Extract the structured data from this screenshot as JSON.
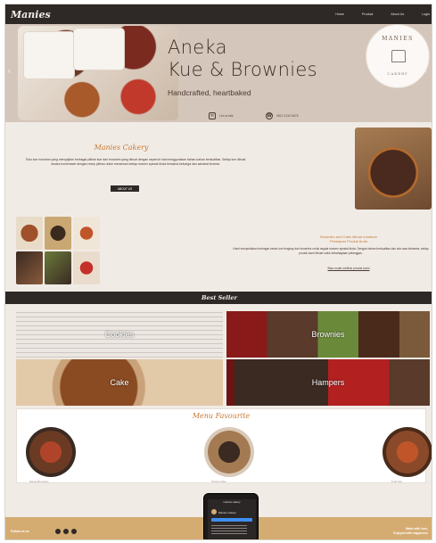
{
  "brand": {
    "logo": "Manies"
  },
  "nav": [
    "Home",
    "Product",
    "About Us",
    "Login"
  ],
  "hero": {
    "line1": "Aneka",
    "line2": "Kue & Brownies",
    "tagline": "Handcrafted, heartbaked",
    "badge_top": "MANIES",
    "badge_bottom": "CAKERY",
    "contact_email": "Let us talk",
    "contact_phone": "0813 1234 5678"
  },
  "about": {
    "title": "Manies Cakery",
    "body": "Toko kue rumahan yang menyajikan berbagai pilihan kue dan brownies yang dibuat dengan sepenuh hati menggunakan bahan-bahan berkualitas. Setiap kue dibuat secara homemade dengan resep pilihan untuk menemani setiap momen spesial Anda bersama keluarga dan sahabat tercinta.",
    "button": "ABOUT US"
  },
  "intro": {
    "title_line1": "Brownies and Cake dibuat rumahan",
    "title_line2": "Persiapan Produk Anda",
    "body": "Kami menyediakan berbagai varian kue lengkap dan brownies untuk segala momen spesial Anda. Dengan bahan berkualitas dan cita rasa istimewa, setiap produk kami dibuat untuk kebahagiaan pelanggan.",
    "link": "Bisa mulai melihat produk kami"
  },
  "best_seller": {
    "title": "Best Seller",
    "tiles": [
      "Cookies",
      "Brownies",
      "Cake",
      "Hampers"
    ]
  },
  "menu_favourite": {
    "title": "Menu Favourite",
    "captions": [
      "Sweet Brownies",
      "Choco Cake",
      "Fruit Tart"
    ]
  },
  "footer": {
    "left": "Follow us on",
    "right_line1": "Made with love,",
    "right_line2": "Enjoyed with happiness"
  },
  "phone": {
    "title": "manies.cakery",
    "name": "Manies Cakery"
  },
  "colors": {
    "nav": "#2e2826",
    "hero": "#d5c6bb",
    "accent": "#c47a35",
    "footer": "#d4ac72"
  }
}
